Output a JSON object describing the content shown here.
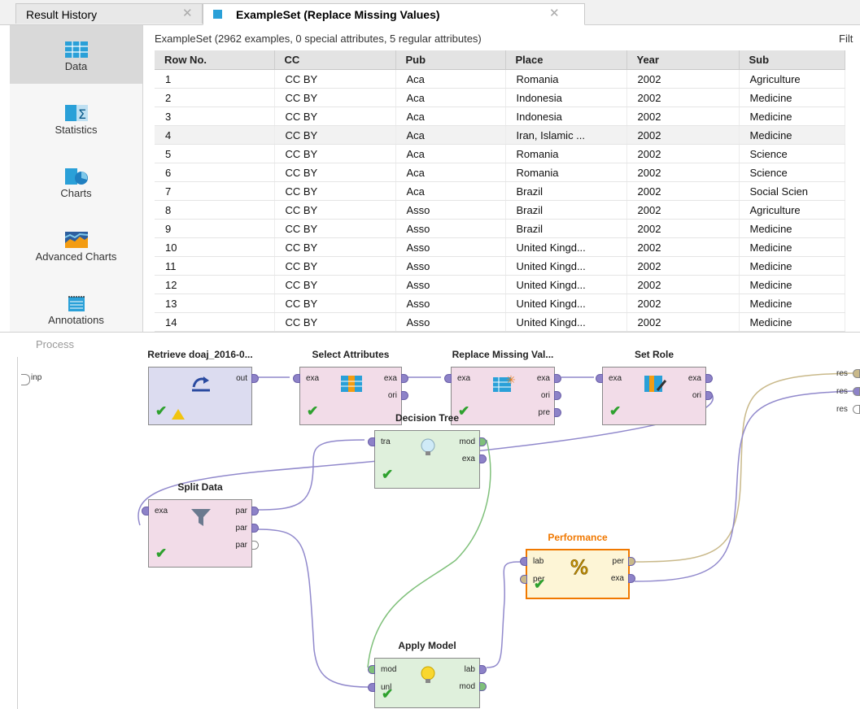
{
  "tabs": [
    {
      "label": "Result History"
    },
    {
      "label": "ExampleSet (Replace Missing Values)"
    }
  ],
  "close_glyph": "✕",
  "sidebar": {
    "items": [
      {
        "label": "Data",
        "icon": "table-icon"
      },
      {
        "label": "Statistics",
        "icon": "statistics-icon"
      },
      {
        "label": "Charts",
        "icon": "charts-icon"
      },
      {
        "label": "Advanced Charts",
        "icon": "advanced-charts-icon"
      },
      {
        "label": "Annotations",
        "icon": "annotations-icon"
      }
    ]
  },
  "data_view": {
    "summary": "ExampleSet (2962 examples, 0 special attributes, 5 regular attributes)",
    "filter_label": "Filt",
    "columns": [
      "Row No.",
      "CC",
      "Pub",
      "Place",
      "Year",
      "Sub"
    ],
    "rows": [
      [
        "1",
        "CC BY",
        "Aca",
        "Romania",
        "2002",
        "Agriculture"
      ],
      [
        "2",
        "CC BY",
        "Aca",
        "Indonesia",
        "2002",
        "Medicine"
      ],
      [
        "3",
        "CC BY",
        "Aca",
        "Indonesia",
        "2002",
        "Medicine"
      ],
      [
        "4",
        "CC BY",
        "Aca",
        "Iran, Islamic ...",
        "2002",
        "Medicine"
      ],
      [
        "5",
        "CC BY",
        "Aca",
        "Romania",
        "2002",
        "Science"
      ],
      [
        "6",
        "CC BY",
        "Aca",
        "Romania",
        "2002",
        "Science"
      ],
      [
        "7",
        "CC BY",
        "Aca",
        "Brazil",
        "2002",
        "Social Scien"
      ],
      [
        "8",
        "CC BY",
        "Asso",
        "Brazil",
        "2002",
        "Agriculture"
      ],
      [
        "9",
        "CC BY",
        "Asso",
        "Brazil",
        "2002",
        "Medicine"
      ],
      [
        "10",
        "CC BY",
        "Asso",
        "United Kingd...",
        "2002",
        "Medicine"
      ],
      [
        "11",
        "CC BY",
        "Asso",
        "United Kingd...",
        "2002",
        "Medicine"
      ],
      [
        "12",
        "CC BY",
        "Asso",
        "United Kingd...",
        "2002",
        "Medicine"
      ],
      [
        "13",
        "CC BY",
        "Asso",
        "United Kingd...",
        "2002",
        "Medicine"
      ],
      [
        "14",
        "CC BY",
        "Asso",
        "United Kingd...",
        "2002",
        "Medicine"
      ]
    ]
  },
  "process": {
    "title": "Process",
    "input_port": "inp",
    "result_ports": [
      "res",
      "res",
      "res"
    ],
    "operators": [
      {
        "id": "retrieve",
        "name": "Retrieve doaj_2016-0...",
        "in": [],
        "out": [
          "out"
        ],
        "color": "#dcdcf0"
      },
      {
        "id": "select",
        "name": "Select Attributes",
        "in": [
          "exa"
        ],
        "out": [
          "exa",
          "ori"
        ],
        "color": "#f2dce8"
      },
      {
        "id": "replace",
        "name": "Replace Missing Val...",
        "in": [
          "exa"
        ],
        "out": [
          "exa",
          "ori",
          "pre"
        ],
        "color": "#f2dce8"
      },
      {
        "id": "setrole",
        "name": "Set Role",
        "in": [
          "exa"
        ],
        "out": [
          "exa",
          "ori"
        ],
        "color": "#f2dce8"
      },
      {
        "id": "split",
        "name": "Split Data",
        "in": [
          "exa"
        ],
        "out": [
          "par",
          "par",
          "par"
        ],
        "color": "#f2dce8"
      },
      {
        "id": "tree",
        "name": "Decision Tree",
        "in": [
          "tra"
        ],
        "out": [
          "mod",
          "exa"
        ],
        "color": "#dff0dc"
      },
      {
        "id": "perf",
        "name": "Performance",
        "in": [
          "lab",
          "per"
        ],
        "out": [
          "per",
          "exa"
        ],
        "color": "#fdf5d6"
      },
      {
        "id": "apply",
        "name": "Apply Model",
        "in": [
          "mod",
          "unl"
        ],
        "out": [
          "lab",
          "mod"
        ],
        "color": "#dff0dc"
      }
    ]
  },
  "colors": {
    "accent": "#f07800",
    "example_port": "#8d82c8",
    "model_port": "#7fc07a",
    "perf_port": "#c9b98a",
    "check": "#2ea12e"
  }
}
